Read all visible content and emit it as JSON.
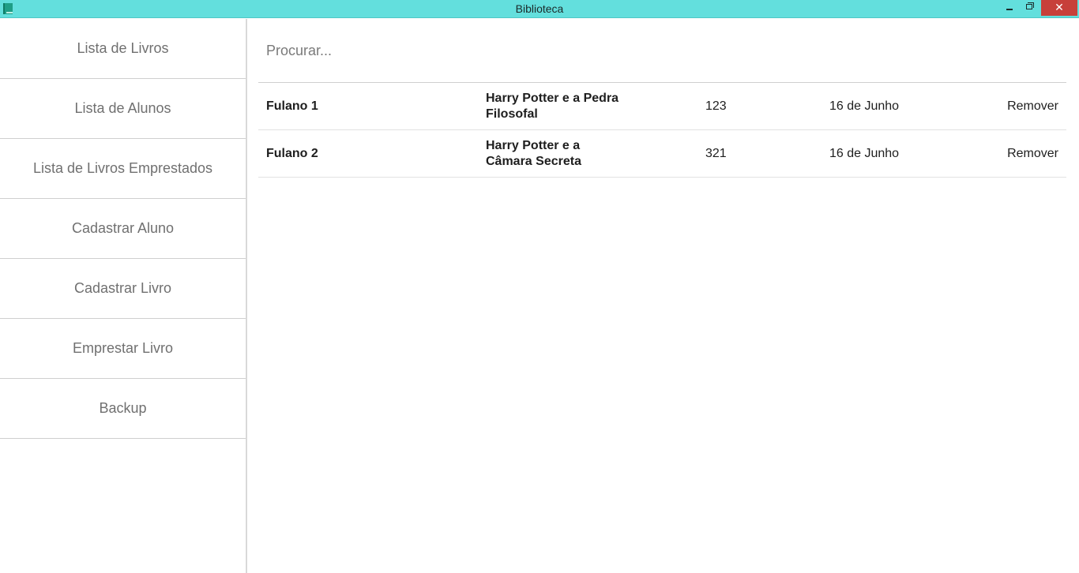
{
  "window": {
    "title": "Biblioteca",
    "minimize_label": "",
    "maximize_label": "",
    "close_label": "✕"
  },
  "sidebar": {
    "items": [
      {
        "label": "Lista de Livros"
      },
      {
        "label": "Lista de Alunos"
      },
      {
        "label": "Lista de Livros Emprestados"
      },
      {
        "label": "Cadastrar Aluno"
      },
      {
        "label": "Cadastrar Livro"
      },
      {
        "label": "Emprestar Livro"
      },
      {
        "label": "Backup"
      }
    ]
  },
  "search": {
    "placeholder": "Procurar...",
    "value": ""
  },
  "loans": [
    {
      "student": "Fulano 1",
      "book": "Harry Potter e a Pedra Filosofal",
      "code": "123",
      "date": "16 de Junho",
      "action": "Remover"
    },
    {
      "student": "Fulano 2",
      "book": "Harry Potter e a Câmara Secreta",
      "code": "321",
      "date": "16 de Junho",
      "action": "Remover"
    }
  ],
  "colors": {
    "titlebar": "#63dfdd",
    "close_button": "#c7403a",
    "sidebar_text": "#707070"
  }
}
